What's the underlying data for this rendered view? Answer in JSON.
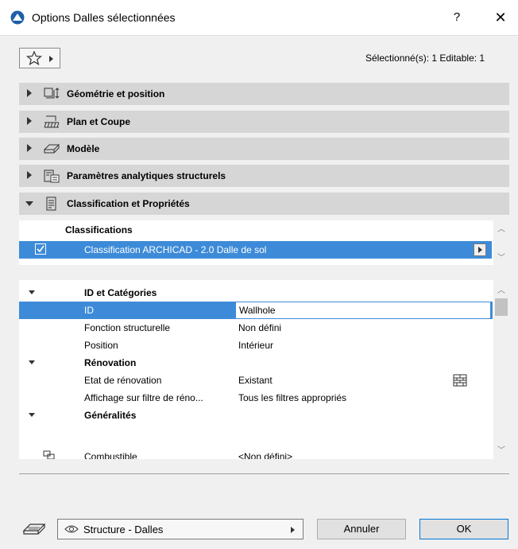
{
  "window": {
    "title": "Options Dalles sélectionnées",
    "help_label": "?",
    "close_label": "✕"
  },
  "toolbar": {
    "selection_info": "Sélectionné(s): 1 Editable: 1"
  },
  "panels": [
    {
      "label": "Géométrie et position",
      "icon": "geometry-icon",
      "expanded": false
    },
    {
      "label": "Plan et Coupe",
      "icon": "plan-section-icon",
      "expanded": false
    },
    {
      "label": "Modèle",
      "icon": "model-icon",
      "expanded": false
    },
    {
      "label": "Paramètres analytiques structurels",
      "icon": "structural-icon",
      "expanded": false
    },
    {
      "label": "Classification et Propriétés",
      "icon": "document-icon",
      "expanded": true
    }
  ],
  "classifications": {
    "header": "Classifications",
    "row_text": "Classification ARCHICAD - 2.0 Dalle de sol",
    "checked": true
  },
  "properties": {
    "groups": [
      {
        "name": "ID et Catégories",
        "rows": [
          {
            "label": "ID",
            "value": "Wallhole",
            "selected": true
          },
          {
            "label": "Fonction structurelle",
            "value": "Non défini"
          },
          {
            "label": "Position",
            "value": "Intérieur"
          }
        ]
      },
      {
        "name": "Rénovation",
        "rows": [
          {
            "label": "Etat de rénovation",
            "value": "Existant",
            "icon": "renovation-brick-icon"
          },
          {
            "label": "Affichage sur filtre de réno...",
            "value": "Tous les filtres appropriés"
          }
        ]
      },
      {
        "name": "Généralités",
        "rows": [
          {
            "label": "Combustible",
            "value": "<Non défini>",
            "icon": "link-icon"
          }
        ]
      }
    ]
  },
  "footer": {
    "layer_label": "Structure - Dalles",
    "cancel_label": "Annuler",
    "ok_label": "OK"
  },
  "colors": {
    "selection": "#3d8bd8",
    "panel_bg": "#d6d6d6",
    "window_bg": "#f0f0f0"
  }
}
